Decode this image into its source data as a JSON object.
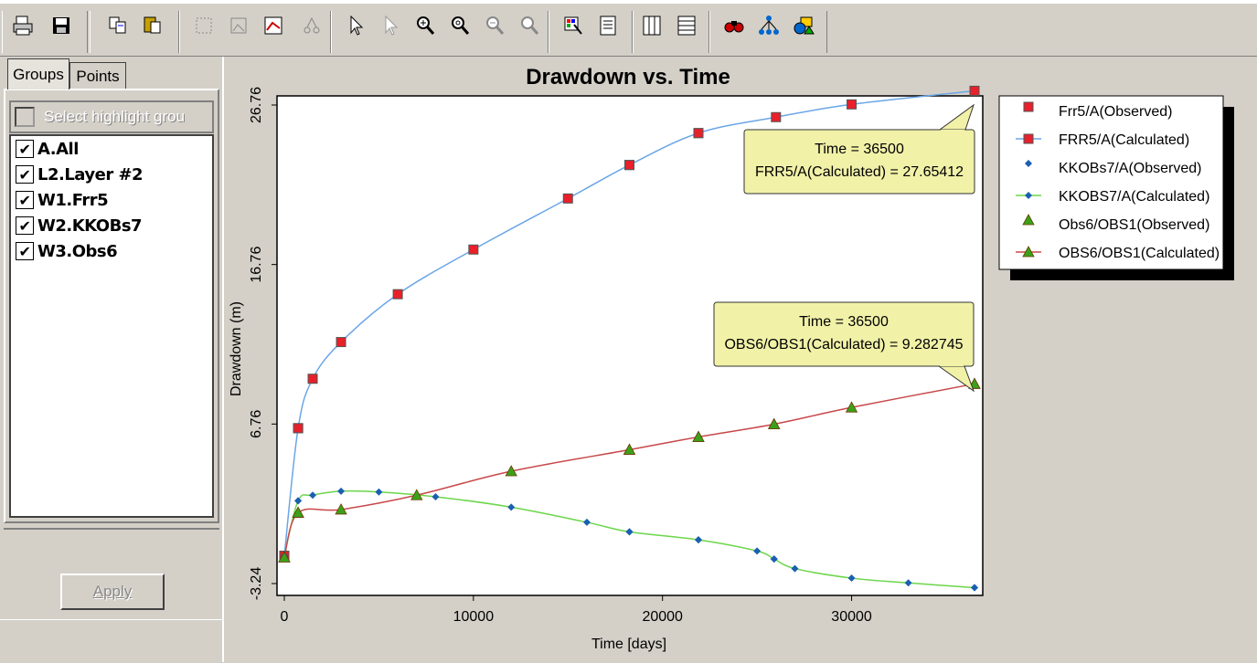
{
  "toolbar": {
    "buttons": [
      "print-icon",
      "save-icon",
      "copy-icon",
      "paste-icon",
      "select-rect-icon",
      "select-image-icon",
      "chart-edit-icon",
      "link-icon",
      "pointer-icon",
      "pointer-alt-icon",
      "zoom-in-icon",
      "zoom-window-icon",
      "zoom-out-icon",
      "zoom-reset-icon",
      "palette-icon",
      "list-icon",
      "columns-icon",
      "rows-icon",
      "binoculars-icon",
      "network-icon",
      "shapes-icon"
    ]
  },
  "tabs": {
    "groups": "Groups",
    "points": "Points"
  },
  "highlight": {
    "placeholder": "Select highlight grou"
  },
  "groups": [
    {
      "label": "A.All",
      "checked": true
    },
    {
      "label": "L2.Layer #2",
      "checked": true
    },
    {
      "label": "W1.Frr5",
      "checked": true
    },
    {
      "label": "W2.KKOBs7",
      "checked": true
    },
    {
      "label": "W3.Obs6",
      "checked": true
    }
  ],
  "apply_label": "Apply",
  "chart_data": {
    "type": "line",
    "title": "Drawdown vs. Time",
    "xlabel": "Time  [days]",
    "ylabel": "Drawdown (m)",
    "xlim": [
      0,
      36500
    ],
    "ylim": [
      -3.24,
      26.76
    ],
    "xticks": [
      0,
      10000,
      20000,
      30000
    ],
    "yticks": [
      -3.24,
      6.76,
      16.76,
      26.76
    ],
    "series": [
      {
        "name": "Frr5/A(Observed)",
        "marker": "square",
        "color": "#e8202a",
        "line": false,
        "x": [
          0,
          730,
          18250,
          21900,
          36500
        ],
        "y": [
          -1.5,
          6.5,
          23.0,
          25.0,
          27.65
        ]
      },
      {
        "name": "FRR5/A(Calculated)",
        "marker": "square",
        "color": "#e8202a",
        "line": true,
        "lineColor": "#6aa6e6",
        "x": [
          0,
          730,
          1500,
          3000,
          6000,
          10000,
          15000,
          18250,
          21900,
          26000,
          30000,
          36500
        ],
        "y": [
          -1.5,
          6.5,
          9.6,
          11.9,
          14.9,
          17.7,
          20.9,
          23.0,
          25.0,
          26.0,
          26.8,
          27.65
        ]
      },
      {
        "name": "KKOBs7/A(Observed)",
        "marker": "diamond",
        "color": "#1a5fb0",
        "line": false,
        "x": [
          0,
          730,
          18250,
          21900,
          25900,
          36500
        ],
        "y": [
          -1.5,
          1.95,
          0.0,
          -0.5,
          -1.7,
          -3.5
        ]
      },
      {
        "name": "KKOBS7/A(Calculated)",
        "marker": "diamond",
        "color": "#1a5fb0",
        "line": true,
        "lineColor": "#6bd64a",
        "x": [
          0,
          730,
          1500,
          3000,
          5000,
          8000,
          12000,
          16000,
          18250,
          21900,
          25000,
          25900,
          27000,
          30000,
          33000,
          36500
        ],
        "y": [
          -1.5,
          1.95,
          2.3,
          2.55,
          2.5,
          2.2,
          1.55,
          0.6,
          0.0,
          -0.5,
          -1.2,
          -1.7,
          -2.3,
          -2.9,
          -3.2,
          -3.5
        ]
      },
      {
        "name": "Obs6/OBS1(Observed)",
        "marker": "triangle",
        "color": "#3aa21a",
        "line": false,
        "x": [
          0,
          730,
          18250,
          21900,
          25900,
          36500
        ],
        "y": [
          -1.6,
          1.2,
          5.15,
          5.95,
          6.75,
          9.28
        ]
      },
      {
        "name": "OBS6/OBS1(Calculated)",
        "marker": "triangle",
        "color": "#3aa21a",
        "line": true,
        "lineColor": "#c8484a",
        "x": [
          0,
          730,
          3000,
          7000,
          12000,
          18250,
          21900,
          25900,
          30000,
          36500
        ],
        "y": [
          -1.6,
          1.2,
          1.4,
          2.3,
          3.8,
          5.15,
          5.95,
          6.75,
          7.8,
          9.28
        ]
      }
    ],
    "callouts": [
      {
        "line1": "Time = 36500",
        "line2": "FRR5/A(Calculated) = 27.65412"
      },
      {
        "line1": "Time = 36500",
        "line2": "OBS6/OBS1(Calculated) = 9.282745"
      }
    ],
    "legend_position": "right"
  }
}
